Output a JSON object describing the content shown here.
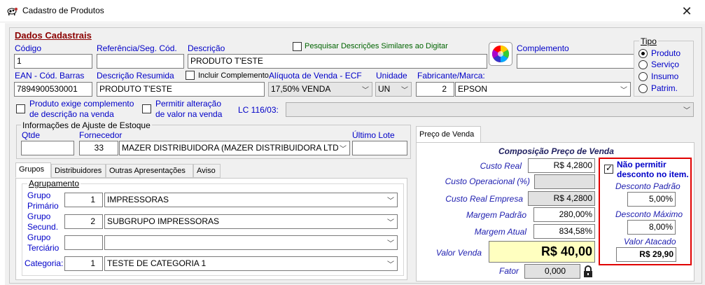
{
  "window": {
    "title": "Cadastro de Produtos",
    "close_glyph": "✕"
  },
  "section_title": "Dados Cadastrais",
  "fields": {
    "codigo": {
      "label": "Código",
      "value": "1"
    },
    "referencia": {
      "label": "Referência/Seg. Cód.",
      "value": ""
    },
    "descricao": {
      "label": "Descrição",
      "value": "PRODUTO T'ESTE"
    },
    "pesquisar_label": "Pesquisar Descrições Similares ao Digitar",
    "complemento": {
      "label": "Complemento",
      "value": ""
    },
    "ean": {
      "label": "EAN - Cód. Barras",
      "value": "7894900530001"
    },
    "descricao_resumida": {
      "label": "Descrição Resumida",
      "value": "PRODUTO T'ESTE"
    },
    "incluir_complemento_label": "Incluir Complemento",
    "aliquota": {
      "label": "Alíquota de Venda - ECF",
      "value": "17,50% VENDA"
    },
    "unidade": {
      "label": "Unidade",
      "value": "UN"
    },
    "fabricante": {
      "label": "Fabricante/Marca:",
      "code": "2",
      "value": "EPSON"
    },
    "exige_complemento_label_1": "Produto exige complemento",
    "exige_complemento_label_2": "de descrição na venda",
    "permitir_alteracao_label_1": "Permitir alteração",
    "permitir_alteracao_label_2": "de valor na venda",
    "lc116_label": "LC 116/03:",
    "lc116_value": ""
  },
  "tipo": {
    "label": "Tipo",
    "options": [
      "Produto",
      "Serviço",
      "Insumo",
      "Patrim."
    ],
    "selected": "Produto"
  },
  "ajuste_estoque": {
    "title": "Informações de Ajuste de Estoque",
    "qtde_label": "Qtde",
    "qtde_value": "",
    "fornecedor_label": "Fornecedor",
    "fornecedor_code": "33",
    "fornecedor_value": "MAZER DISTRIBUIDORA (MAZER DISTRIBUIDORA LTDA",
    "ultimo_lote_label": "Último Lote",
    "ultimo_lote_value": ""
  },
  "tabs": [
    "Grupos",
    "Distribuidores",
    "Outras Apresentações",
    "Aviso"
  ],
  "agrupamento": {
    "title": "Agrupamento",
    "grupo_primario": {
      "label_1": "Grupo",
      "label_2": "Primário",
      "code": "1",
      "value": "IMPRESSORAS"
    },
    "grupo_secundario": {
      "label_1": "Grupo",
      "label_2": "Secund.",
      "code": "2",
      "value": "SUBGRUPO IMPRESSORAS"
    },
    "grupo_terciario": {
      "label_1": "Grupo",
      "label_2": "Terciário",
      "code": "",
      "value": ""
    },
    "categoria": {
      "label": "Categoria:",
      "code": "1",
      "value": "TESTE DE CATEGORIA 1"
    }
  },
  "preco": {
    "tab": "Preço de Venda",
    "title": "Composição Preço de Venda",
    "custo_real": {
      "label": "Custo Real",
      "value": "R$ 4,2800"
    },
    "custo_operacional": {
      "label": "Custo Operacional (%)",
      "value": ""
    },
    "custo_real_empresa": {
      "label": "Custo Real Empresa",
      "value": "R$ 4,2800"
    },
    "margem_padrao": {
      "label": "Margem Padrão",
      "value": "280,00%"
    },
    "margem_atual": {
      "label": "Margem Atual",
      "value": "834,58%"
    },
    "valor_venda": {
      "label": "Valor Venda",
      "value": "R$ 40,00"
    },
    "fator": {
      "label": "Fator",
      "value": "0,000"
    }
  },
  "desconto": {
    "nao_permitir_1": "Não permitir",
    "nao_permitir_2": "desconto no item.",
    "padrao_label": "Desconto Padrão",
    "padrao_value": "5,00%",
    "maximo_label": "Desconto Máximo",
    "maximo_value": "8,00%",
    "atacado_label": "Valor Atacado",
    "atacado_value": "R$ 29,90"
  },
  "colors": {
    "label_blue": "#0000c8",
    "section_red": "#8b0000",
    "highlight_red": "#e00000",
    "valor_venda_bg": "#ffffc0"
  }
}
